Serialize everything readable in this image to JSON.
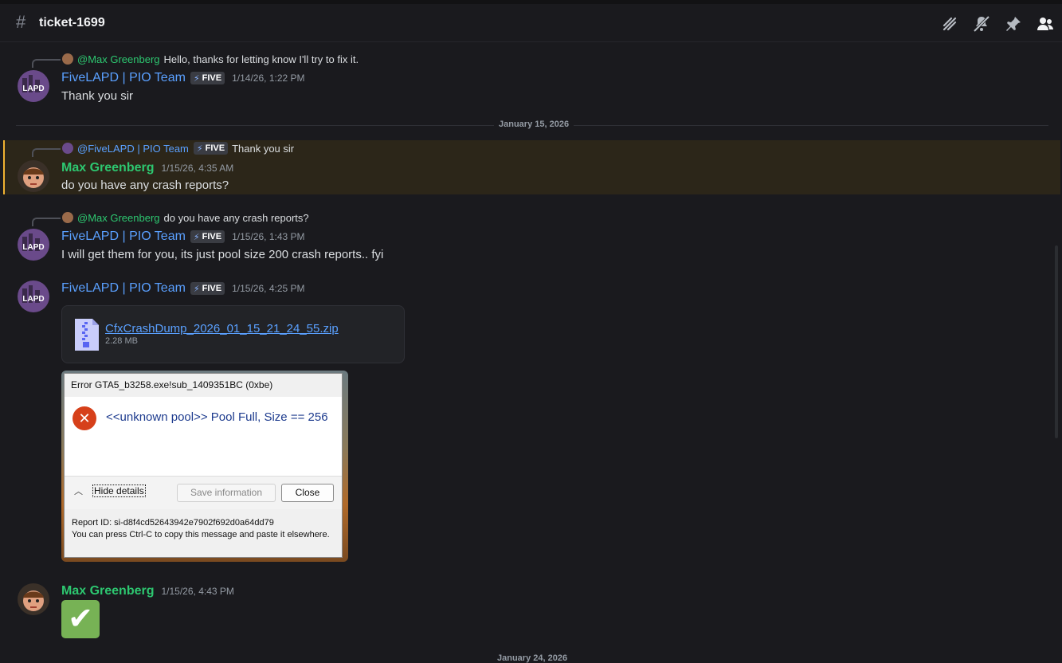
{
  "channel": {
    "name": "ticket-1699"
  },
  "messages": [
    {
      "reply_to": {
        "author": "@Max Greenberg",
        "text": "Hello, thanks for letting know  I'll try to fix it."
      },
      "author": "FiveLAPD | PIO Team",
      "tag": "FIVE",
      "time": "1/14/26, 1:22 PM",
      "text": "Thank you sir"
    },
    {
      "reply_to": {
        "author": "@FiveLAPD | PIO Team",
        "tag": "FIVE",
        "text": "Thank you sir"
      },
      "author": "Max Greenberg",
      "time": "1/15/26, 4:35 AM",
      "text": "do you have any crash reports?"
    },
    {
      "reply_to": {
        "author": "@Max Greenberg",
        "text": "do you have any crash reports?"
      },
      "author": "FiveLAPD | PIO Team",
      "tag": "FIVE",
      "time": "1/15/26, 1:43 PM",
      "text": "I will get them for you, its just pool size 200 crash reports.. fyi"
    },
    {
      "author": "FiveLAPD | PIO Team",
      "tag": "FIVE",
      "time": "1/15/26, 4:25 PM",
      "attachment": {
        "name": "CfxCrashDump_2026_01_15_21_24_55.zip",
        "size": "2.28 MB"
      },
      "screenshot": {
        "title": "Error GTA5_b3258.exe!sub_1409351BC (0xbe)",
        "message": "<<unknown pool>> Pool Full, Size == 256",
        "hide_details": "Hide details",
        "save_info": "Save information",
        "close": "Close",
        "report_id": "Report ID: si-d8f4cd52643942e7902f692d0a64dd79",
        "copy_hint": "You can press Ctrl-C to copy this message and paste it elsewhere."
      }
    },
    {
      "author": "Max Greenberg",
      "time": "1/15/26, 4:43 PM",
      "reaction": "✔"
    }
  ],
  "dividers": {
    "first": "January 15, 2026",
    "second": "January 24, 2026"
  },
  "icons": [
    "threads-icon",
    "mute-icon",
    "pin-icon",
    "members-icon"
  ]
}
